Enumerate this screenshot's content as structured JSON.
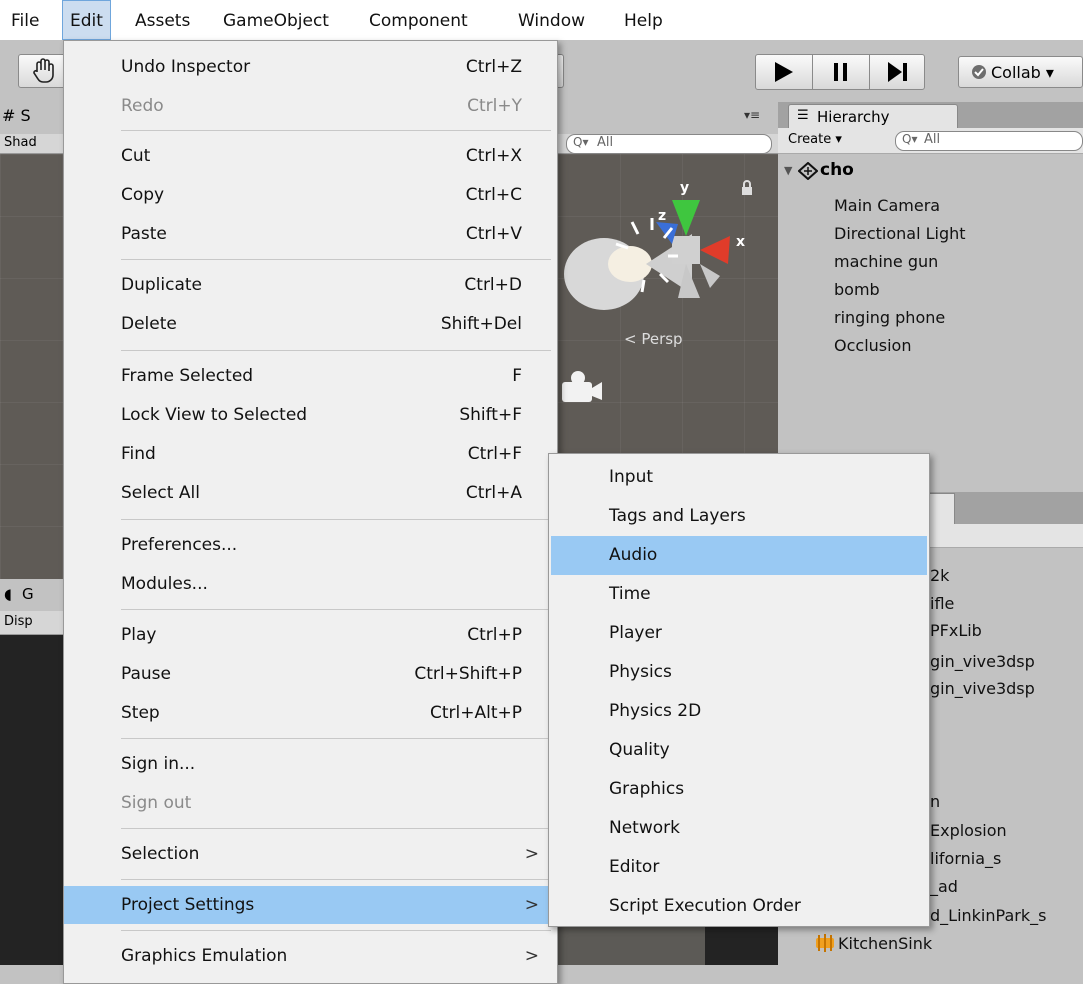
{
  "menubar": {
    "items": [
      "File",
      "Edit",
      "Assets",
      "GameObject",
      "Component",
      "Window",
      "Help"
    ]
  },
  "toolbar": {
    "collab_label": "Collab ▾"
  },
  "scene": {
    "tab_label": "# S",
    "shading_label": "Shad",
    "search_placeholder": "All",
    "persp_label": "< Persp",
    "gizmo_y": "y",
    "gizmo_z": "z",
    "gizmo_x": "x"
  },
  "game": {
    "tab_label": "G",
    "display_label": "Disp"
  },
  "hierarchy": {
    "tab_label": "Hierarchy",
    "create_label": "Create ▾",
    "search_placeholder": "All",
    "scene_name": "cho",
    "items": [
      "Main Camera",
      "Directional Light",
      "machine gun",
      "bomb",
      "ringing phone",
      "Occlusion"
    ]
  },
  "project": {
    "items": [
      "2k",
      "ifle",
      "PFxLib",
      "gin_vive3dsp",
      "gin_vive3dsp",
      "n",
      "Explosion",
      "lifornia_s",
      "_ad",
      "d_LinkinPark_s",
      "KitchenSink"
    ]
  },
  "edit_menu": {
    "items": [
      {
        "label": "Undo Inspector",
        "shortcut": "Ctrl+Z"
      },
      {
        "label": "Redo",
        "shortcut": "Ctrl+Y"
      },
      {
        "label": "Cut",
        "shortcut": "Ctrl+X"
      },
      {
        "label": "Copy",
        "shortcut": "Ctrl+C"
      },
      {
        "label": "Paste",
        "shortcut": "Ctrl+V"
      },
      {
        "label": "Duplicate",
        "shortcut": "Ctrl+D"
      },
      {
        "label": "Delete",
        "shortcut": "Shift+Del"
      },
      {
        "label": "Frame Selected",
        "shortcut": "F"
      },
      {
        "label": "Lock View to Selected",
        "shortcut": "Shift+F"
      },
      {
        "label": "Find",
        "shortcut": "Ctrl+F"
      },
      {
        "label": "Select All",
        "shortcut": "Ctrl+A"
      },
      {
        "label": "Preferences...",
        "shortcut": ""
      },
      {
        "label": "Modules...",
        "shortcut": ""
      },
      {
        "label": "Play",
        "shortcut": "Ctrl+P"
      },
      {
        "label": "Pause",
        "shortcut": "Ctrl+Shift+P"
      },
      {
        "label": "Step",
        "shortcut": "Ctrl+Alt+P"
      },
      {
        "label": "Sign in...",
        "shortcut": ""
      },
      {
        "label": "Sign out",
        "shortcut": ""
      },
      {
        "label": "Selection",
        "shortcut": ""
      },
      {
        "label": "Project Settings",
        "shortcut": ""
      },
      {
        "label": "Graphics Emulation",
        "shortcut": ""
      }
    ],
    "submenu_arrow": ">"
  },
  "project_settings_menu": {
    "items": [
      "Input",
      "Tags and Layers",
      "Audio",
      "Time",
      "Player",
      "Physics",
      "Physics 2D",
      "Quality",
      "Graphics",
      "Network",
      "Editor",
      "Script Execution Order"
    ],
    "highlighted": "Audio"
  }
}
